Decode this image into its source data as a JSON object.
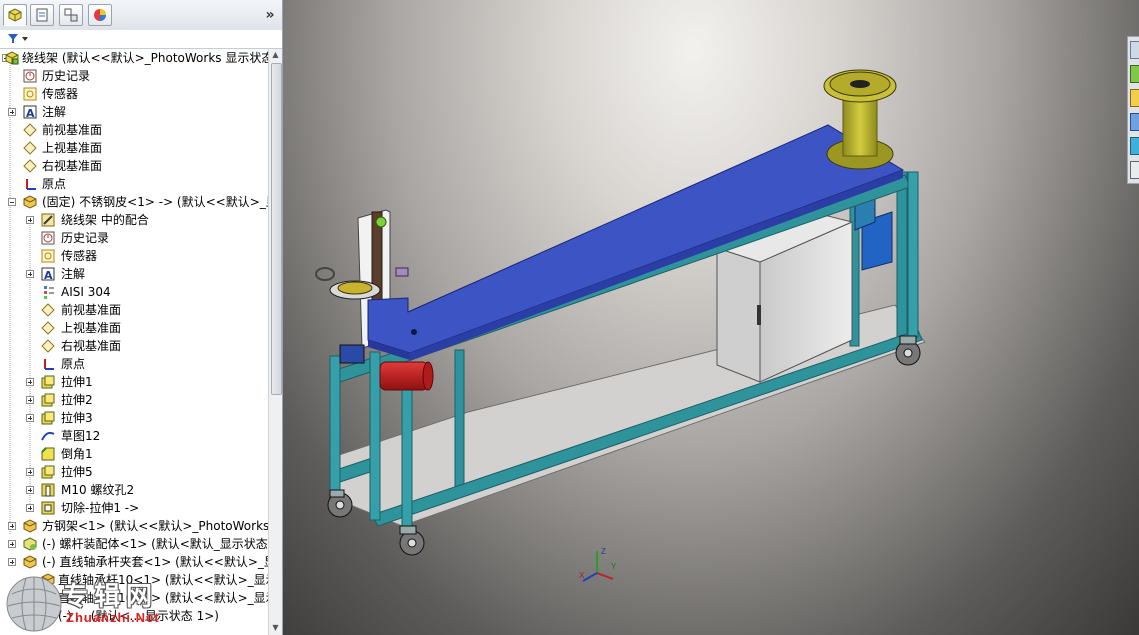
{
  "panel": {
    "tabs": [
      "featuremanager-icon",
      "propertymanager-icon",
      "configurationmanager-icon",
      "displaymanager-icon"
    ],
    "expand_label": "»"
  },
  "tree": {
    "rows": [
      {
        "label": "绕线架  (默认<<默认>_PhotoWorks 显示状态",
        "icon": "assembly-icon"
      },
      {
        "label": "历史记录",
        "icon": "history-icon"
      },
      {
        "label": "传感器",
        "icon": "sensor-icon"
      },
      {
        "label": "注解",
        "icon": "annotation-icon"
      },
      {
        "label": "前视基准面",
        "icon": "plane-icon"
      },
      {
        "label": "上视基准面",
        "icon": "plane-icon"
      },
      {
        "label": "右视基准面",
        "icon": "plane-icon"
      },
      {
        "label": "原点",
        "icon": "origin-icon"
      },
      {
        "label": "(固定) 不锈钢皮<1> -> (默认<<默认>_显",
        "icon": "part-icon"
      },
      {
        "label": "绕线架 中的配合",
        "icon": "mates-icon"
      },
      {
        "label": "历史记录",
        "icon": "history-icon"
      },
      {
        "label": "传感器",
        "icon": "sensor-icon"
      },
      {
        "label": "注解",
        "icon": "annotation-icon"
      },
      {
        "label": "AISI 304",
        "icon": "material-icon"
      },
      {
        "label": "前视基准面",
        "icon": "plane-icon"
      },
      {
        "label": "上视基准面",
        "icon": "plane-icon"
      },
      {
        "label": "右视基准面",
        "icon": "plane-icon"
      },
      {
        "label": "原点",
        "icon": "origin-icon"
      },
      {
        "label": "拉伸1",
        "icon": "extrude-icon"
      },
      {
        "label": "拉伸2",
        "icon": "extrude-icon"
      },
      {
        "label": "拉伸3",
        "icon": "extrude-icon"
      },
      {
        "label": "草图12",
        "icon": "sketch-icon"
      },
      {
        "label": "倒角1",
        "icon": "chamfer-icon"
      },
      {
        "label": "拉伸5",
        "icon": "extrude-icon"
      },
      {
        "label": "M10 螺纹孔2",
        "icon": "hole-icon"
      },
      {
        "label": "切除-拉伸1 ->",
        "icon": "cut-icon"
      },
      {
        "label": "方钢架<1> (默认<<默认>_PhotoWorks",
        "icon": "part-icon"
      },
      {
        "label": "(-) 螺杆装配体<1> (默认<默认_显示状态-",
        "icon": "subassembly-icon"
      },
      {
        "label": "(-) 直线轴承杆夹套<1> (默认<<默认>_显",
        "icon": "part-icon"
      },
      {
        "label": "直线轴承杆10<1> (默认<<默认>_显示",
        "icon": "part-icon"
      },
      {
        "label": "直线轴承杆10<2> (默认<<默认>_显示",
        "icon": "part-icon"
      },
      {
        "label": "(-) ... (默认<... 显示状态 1>)",
        "icon": "part-icon"
      }
    ]
  },
  "viewport": {
    "triad_axes": [
      "X",
      "Y",
      "Z"
    ],
    "taskpane_icons": [
      "resources-icon",
      "design-library-icon",
      "file-explorer-icon",
      "view-palette-icon",
      "appearances-icon",
      "custom-properties-icon"
    ]
  },
  "watermark": {
    "main": "专辑网",
    "sub": "Zhuanzhi.Net"
  },
  "colors": {
    "table_top": "#3d54c4",
    "frame": "#2e8f99",
    "spool": "#b7b12e",
    "cabinet": "#d9d9d9",
    "motor": "#c81e1e"
  }
}
